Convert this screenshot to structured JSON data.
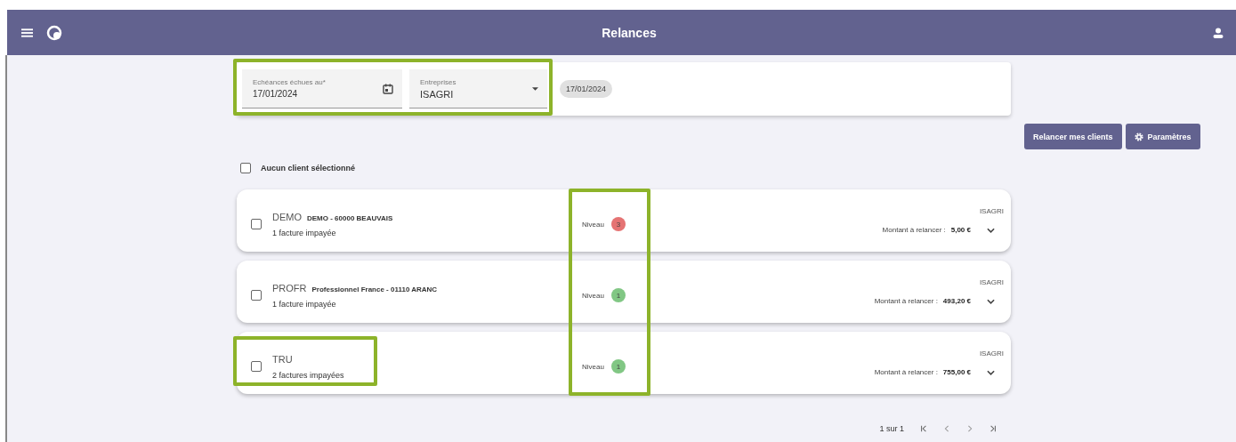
{
  "header": {
    "title": "Relances"
  },
  "filters": {
    "highlighted": true,
    "date_field": {
      "label": "Echéances échues au*",
      "value": "17/01/2024"
    },
    "company_select": {
      "label": "Entreprises",
      "value": "ISAGRI"
    },
    "date_chip": "17/01/2024"
  },
  "actions": [
    {
      "kind": "plain",
      "label": "Relancer mes clients"
    },
    {
      "kind": "settings",
      "label": "Paramètres"
    }
  ],
  "select_all": {
    "label": "Aucun client sélectionné",
    "checked": false
  },
  "level_column_highlighted": true,
  "clients": [
    {
      "code": "DEMO",
      "name": "DEMO - 60000 BEAUVAIS",
      "invoices": "1 facture impayée",
      "checked": false,
      "name_highlighted": false,
      "level_label": "Niveau",
      "level": "3",
      "color": "#e57373",
      "company": "ISAGRI",
      "amount_label": "Montant à relancer :",
      "amount": "5,00 €"
    },
    {
      "code": "PROFR",
      "name": "Professionnel France - 01110 ARANC",
      "invoices": "1 facture impayée",
      "checked": false,
      "name_highlighted": false,
      "level_label": "Niveau",
      "level": "1",
      "color": "#81c784",
      "company": "ISAGRI",
      "amount_label": "Montant à relancer :",
      "amount": "493,20 €"
    },
    {
      "code": "TRU",
      "invoices": "2 factures impayées",
      "checked": false,
      "name_highlighted": true,
      "level_label": "Niveau",
      "level": "1",
      "color": "#81c784",
      "company": "ISAGRI",
      "amount_label": "Montant à relancer :",
      "amount": "755,00 €"
    }
  ],
  "pagination": {
    "range": "1 sur 1"
  }
}
